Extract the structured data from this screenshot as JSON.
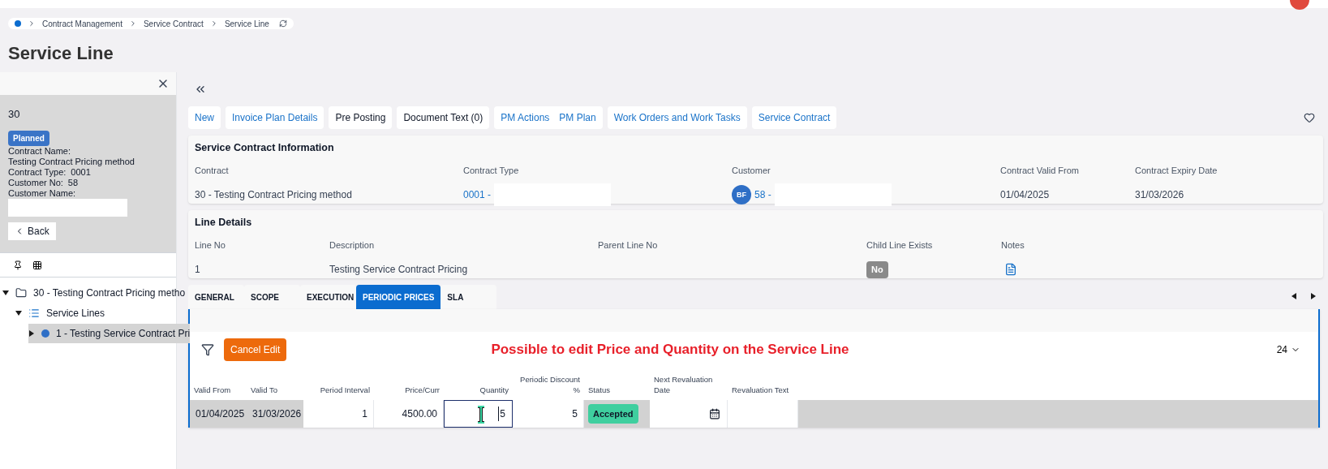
{
  "breadcrumb": [
    "Contract Management",
    "Service Contract",
    "Service Line"
  ],
  "page_title": "Service Line",
  "side_panel": {
    "record": "30",
    "status": "Planned",
    "fields": [
      {
        "label": "Contract Name:",
        "value": "Testing Contract Pricing method",
        "kind": "block"
      },
      {
        "label": "Contract Type:",
        "value": "0001",
        "kind": "inline"
      },
      {
        "label": "Customer No:",
        "value": "58",
        "kind": "inline"
      },
      {
        "label": "Customer Name:",
        "kind": "redacted"
      }
    ],
    "back_button": "Back"
  },
  "tree": [
    {
      "label": "30 - Testing Contract Pricing metho",
      "kind": "contract",
      "expanded": true,
      "selected": false,
      "children": [
        {
          "label": "Service Lines",
          "kind": "list",
          "expanded": true,
          "selected": false,
          "children": [
            {
              "label": "1 - Testing Service Contract Pri",
              "kind": "line",
              "expanded": false,
              "selected": true
            }
          ]
        }
      ]
    }
  ],
  "actions": [
    {
      "items": [
        {
          "label": "New",
          "kind": "link"
        }
      ]
    },
    {
      "items": [
        {
          "label": "Invoice Plan Details",
          "kind": "link"
        }
      ]
    },
    {
      "items": [
        {
          "label": "Pre Posting",
          "kind": "plain"
        }
      ]
    },
    {
      "items": [
        {
          "label": "Document Text (0)",
          "kind": "plain"
        }
      ]
    },
    {
      "items": [
        {
          "label": "PM Actions",
          "kind": "link"
        },
        {
          "label": "PM Plan",
          "kind": "link"
        }
      ]
    },
    {
      "items": [
        {
          "label": "Work Orders and Work Tasks",
          "kind": "link"
        }
      ]
    },
    {
      "items": [
        {
          "label": "Service Contract",
          "kind": "link"
        }
      ]
    }
  ],
  "contract_info": {
    "title": "Service Contract Information",
    "fields": [
      {
        "label": "Contract",
        "value": "30 - Testing Contract Pricing method",
        "kind": "text"
      },
      {
        "label": "Contract Type",
        "value": "0001 -",
        "kind": "link",
        "redacted": true
      },
      {
        "label": "Customer",
        "value": "58 -",
        "kind": "customer",
        "avatar": "BF",
        "redacted": true
      },
      {
        "label": "Contract Valid From",
        "value": "01/04/2025",
        "kind": "text"
      },
      {
        "label": "Contract Expiry Date",
        "value": "31/03/2026",
        "kind": "text"
      }
    ]
  },
  "line_details": {
    "title": "Line Details",
    "fields": [
      {
        "label": "Line No",
        "value": "1",
        "kind": "text"
      },
      {
        "label": "Description",
        "value": "Testing Service Contract Pricing",
        "kind": "text"
      },
      {
        "label": "Parent Line No",
        "kind": "text"
      },
      {
        "label": "Child Line Exists",
        "value": "No",
        "kind": "badge"
      },
      {
        "label": "Notes",
        "kind": "notes"
      }
    ]
  },
  "tabs": [
    {
      "label": "GENERAL",
      "selected": false
    },
    {
      "label": "SCOPE",
      "selected": false
    },
    {
      "label": "EXECUTION",
      "selected": false
    },
    {
      "label": "PERIODIC PRICES",
      "selected": true
    },
    {
      "label": "SLA",
      "selected": false
    }
  ],
  "table": {
    "cancel_button": "Cancel Edit",
    "annotation": "Possible to edit Price and Quantity on the Service Line",
    "page_size": "24",
    "columns": [
      "Valid From",
      "Valid To",
      "Period Interval",
      "Price/Curr",
      "Quantity",
      "Periodic Discount %",
      "Status",
      "Next Revaluation Date",
      "Revaluation Text"
    ],
    "rows": [
      {
        "cells": [
          {
            "value": "01/04/2025",
            "kind": "readonly"
          },
          {
            "value": "31/03/2026",
            "kind": "readonly"
          },
          {
            "value": "1",
            "kind": "editable"
          },
          {
            "value": "4500.00",
            "kind": "editable"
          },
          {
            "value": "5",
            "kind": "focused"
          },
          {
            "value": "5",
            "kind": "editable"
          },
          {
            "value": "Accepted",
            "kind": "status"
          },
          {
            "kind": "date"
          },
          {
            "kind": "editable"
          }
        ]
      }
    ]
  }
}
